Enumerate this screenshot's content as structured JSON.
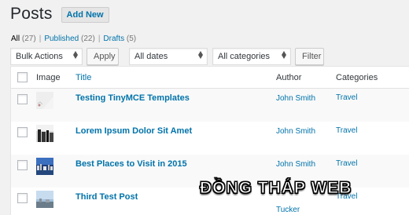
{
  "header": {
    "title": "Posts",
    "add_new_label": "Add New"
  },
  "filters": {
    "all_label": "All",
    "all_count": "(27)",
    "published_label": "Published",
    "published_count": "(22)",
    "drafts_label": "Drafts",
    "drafts_count": "(5)",
    "separator": "|"
  },
  "tablenav": {
    "bulk_actions": "Bulk Actions",
    "apply_label": "Apply",
    "dates": "All dates",
    "categories": "All categories",
    "filter_label": "Filter"
  },
  "columns": {
    "image": "Image",
    "title": "Title",
    "author": "Author",
    "categories": "Categories"
  },
  "posts": [
    {
      "title": "Testing TinyMCE Templates",
      "author": "John Smith",
      "category": "Travel",
      "thumb": "blank"
    },
    {
      "title": "Lorem Ipsum Dolor Sit Amet",
      "author": "John Smith",
      "category": "Travel",
      "thumb": "dark"
    },
    {
      "title": "Best Places to Visit in 2015",
      "author": "John Smith",
      "category": "Travel",
      "thumb": "city"
    },
    {
      "title": "Third Test Post",
      "author": "Tucker",
      "category": "Travel",
      "thumb": "sky"
    }
  ],
  "watermark": "ĐỒNG THÁP WEB",
  "colors": {
    "link": "#0073aa",
    "background": "#f1f1f1"
  }
}
